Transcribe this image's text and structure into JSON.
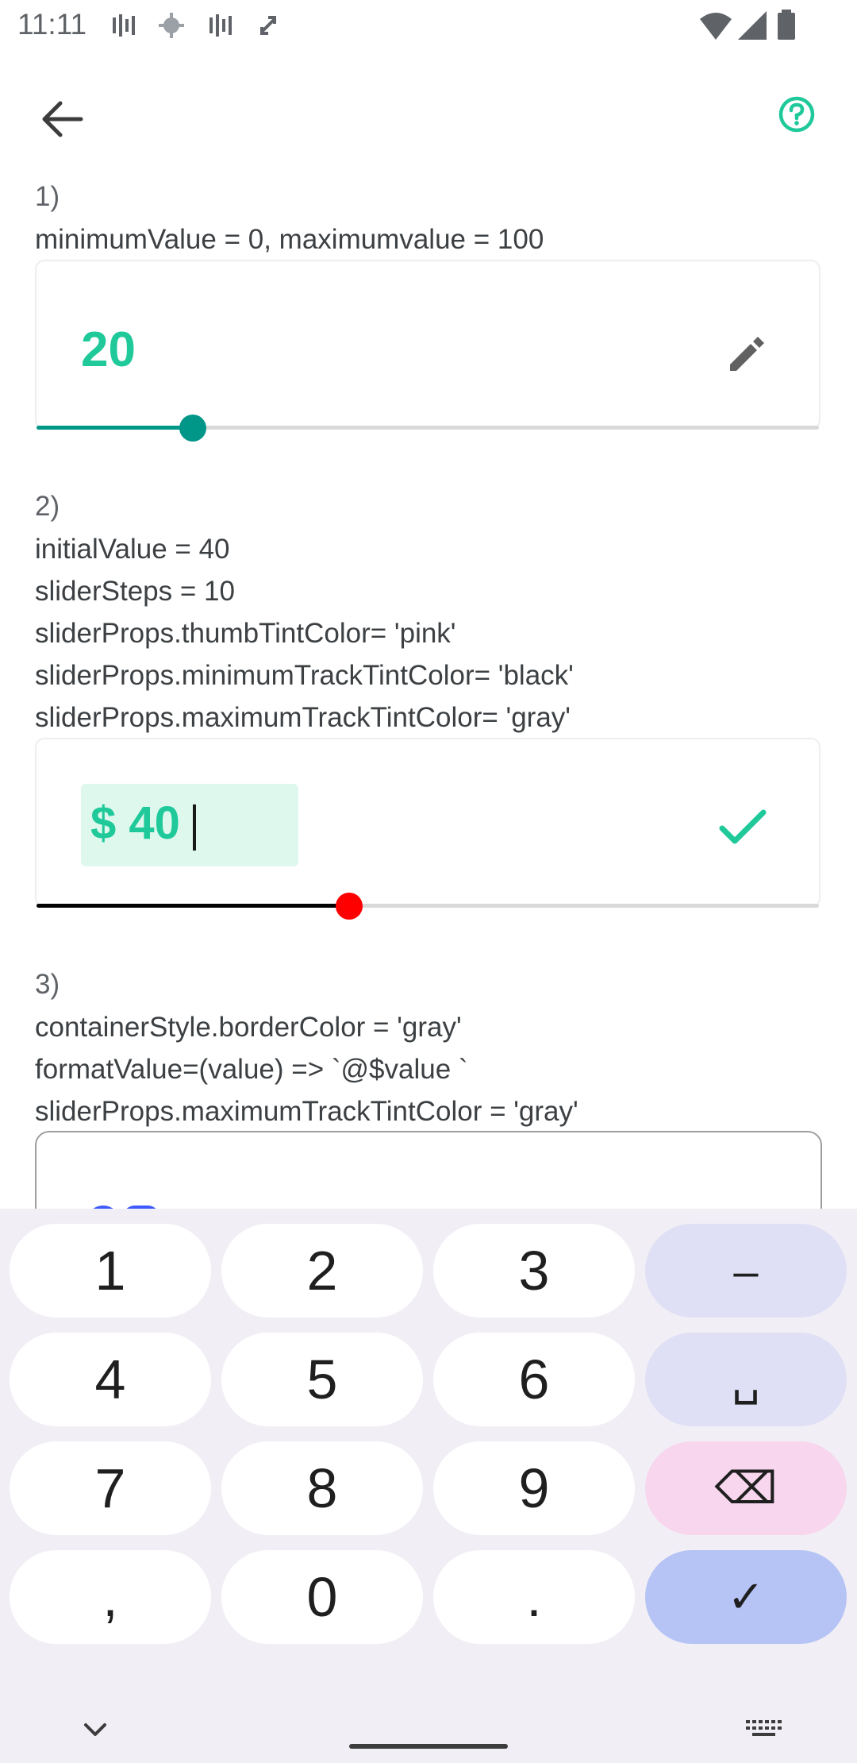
{
  "status_bar": {
    "time": "11:11"
  },
  "app_bar": {
    "back_icon": "arrow-left-icon",
    "help_icon": "help-circle-icon",
    "accent_color": "#1fc99a"
  },
  "section1": {
    "label": "1)",
    "lines": [
      "minimumValue = 0, maximumvalue = 100"
    ],
    "value": "20",
    "slider_fraction": 0.2,
    "edit_icon": "pencil-icon"
  },
  "section2": {
    "label": "2)",
    "lines": [
      "initialValue = 40",
      "sliderSteps = 10",
      "sliderProps.thumbTintColor= 'pink'",
      "sliderProps.minimumTrackTintColor= 'black'",
      "sliderProps.maximumTrackTintColor= 'gray'"
    ],
    "input_value": "$ 40",
    "slider_fraction": 0.4,
    "confirm_icon": "check-icon",
    "thumb_color": "#ff0000",
    "min_track_color": "#000000"
  },
  "section3": {
    "label": "3)",
    "lines": [
      "containerStyle.borderColor = 'gray'",
      "formatValue=(value) => `@$value `",
      "sliderProps.maximumTrackTintColor = 'gray'"
    ]
  },
  "keyboard": {
    "rows": [
      [
        "1",
        "2",
        "3",
        "–"
      ],
      [
        "4",
        "5",
        "6",
        "␣"
      ],
      [
        "7",
        "8",
        "9",
        "⌫"
      ],
      [
        ",",
        "0",
        ".",
        "✓"
      ]
    ],
    "hide_icon": "chevron-down-icon",
    "switch_icon": "keyboard-icon"
  }
}
